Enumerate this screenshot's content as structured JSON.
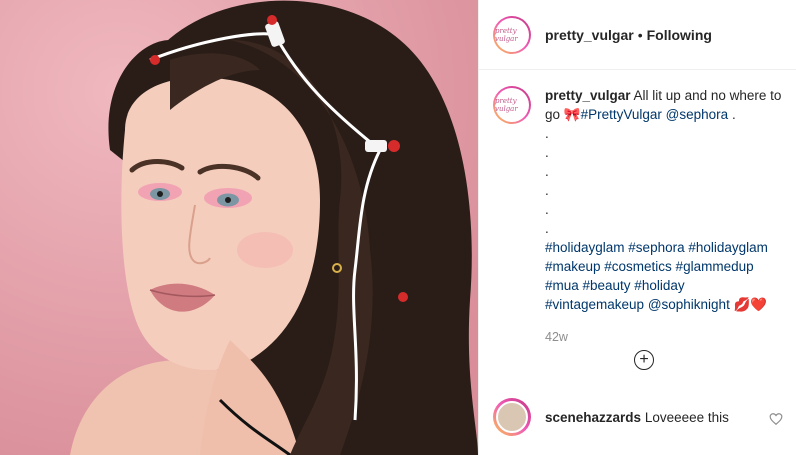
{
  "header": {
    "username": "pretty_vulgar",
    "separator": "•",
    "follow_status": "Following",
    "avatar_text": "pretty vulgar"
  },
  "post": {
    "username": "pretty_vulgar",
    "text_1": "All lit up and no where to go",
    "emoji_1": "🎀",
    "tag_1": "#PrettyVulgar",
    "mention_1": "@sephora",
    "end_dot": ".",
    "dots": [
      ".",
      ".",
      ".",
      ".",
      ".",
      "."
    ],
    "hashtag_lines": [
      "#holidayglam #sephora #holidayglam",
      "#makeup #cosmetics #glammedup",
      "#mua #beauty #holiday"
    ],
    "last_line_tags": "#vintagemakeup @sophiknight",
    "last_line_emoji": "💋❤️",
    "timestamp": "42w"
  },
  "load_more": "+",
  "comment": {
    "username": "scenehazzards",
    "text": "Loveeeee this"
  },
  "icons": {
    "like": "heart-outline-icon",
    "load_more": "plus-circle-icon"
  },
  "colors": {
    "photo_bg": "#e7a4ad",
    "link": "#00376b",
    "muted": "#8e8e8e"
  }
}
